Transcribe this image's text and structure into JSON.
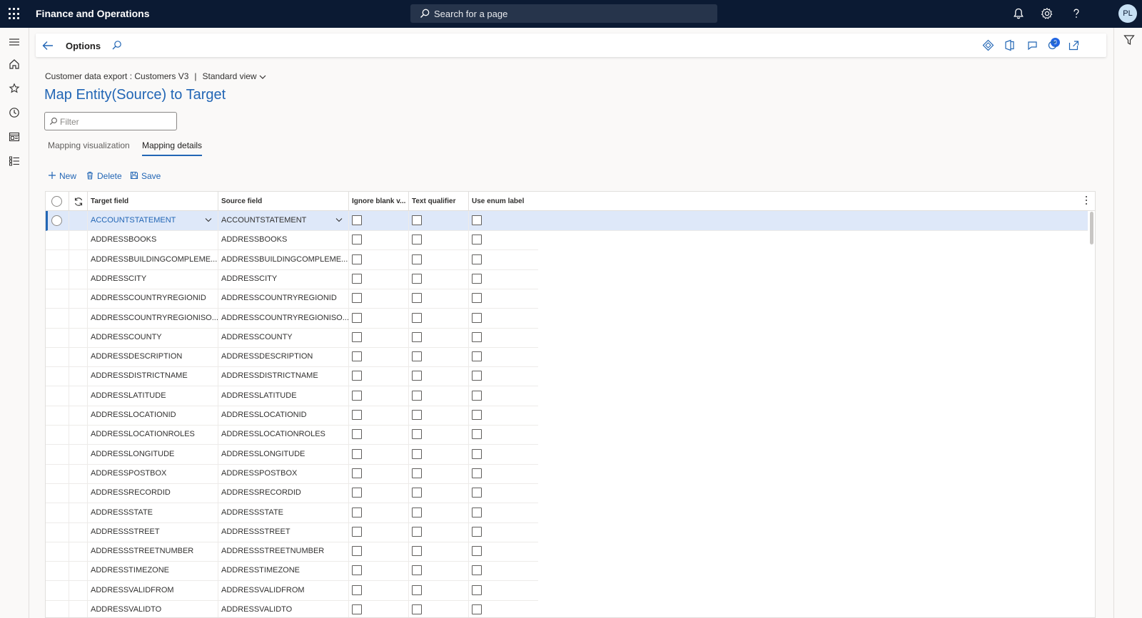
{
  "topbar": {
    "app_title": "Finance and Operations",
    "search_placeholder": "Search for a page",
    "avatar_initials": "PL"
  },
  "actionpane": {
    "title": "Options",
    "notification_count": "0"
  },
  "header": {
    "breadcrumb": "Customer data export : Customers V3",
    "separator": "|",
    "view_name": "Standard view",
    "page_title": "Map Entity(Source) to Target",
    "filter_placeholder": "Filter"
  },
  "tabs": [
    {
      "label": "Mapping visualization"
    },
    {
      "label": "Mapping details"
    }
  ],
  "toolbar": {
    "new_label": "New",
    "delete_label": "Delete",
    "save_label": "Save"
  },
  "grid": {
    "columns": {
      "target": "Target field",
      "source": "Source field",
      "ignore_blank": "Ignore blank v...",
      "text_qualifier": "Text qualifier",
      "use_enum": "Use enum label"
    },
    "rows": [
      {
        "target": "ACCOUNTSTATEMENT",
        "source": "ACCOUNTSTATEMENT"
      },
      {
        "target": "ADDRESSBOOKS",
        "source": "ADDRESSBOOKS"
      },
      {
        "target": "ADDRESSBUILDINGCOMPLEME...",
        "source": "ADDRESSBUILDINGCOMPLEME..."
      },
      {
        "target": "ADDRESSCITY",
        "source": "ADDRESSCITY"
      },
      {
        "target": "ADDRESSCOUNTRYREGIONID",
        "source": "ADDRESSCOUNTRYREGIONID"
      },
      {
        "target": "ADDRESSCOUNTRYREGIONISO...",
        "source": "ADDRESSCOUNTRYREGIONISO..."
      },
      {
        "target": "ADDRESSCOUNTY",
        "source": "ADDRESSCOUNTY"
      },
      {
        "target": "ADDRESSDESCRIPTION",
        "source": "ADDRESSDESCRIPTION"
      },
      {
        "target": "ADDRESSDISTRICTNAME",
        "source": "ADDRESSDISTRICTNAME"
      },
      {
        "target": "ADDRESSLATITUDE",
        "source": "ADDRESSLATITUDE"
      },
      {
        "target": "ADDRESSLOCATIONID",
        "source": "ADDRESSLOCATIONID"
      },
      {
        "target": "ADDRESSLOCATIONROLES",
        "source": "ADDRESSLOCATIONROLES"
      },
      {
        "target": "ADDRESSLONGITUDE",
        "source": "ADDRESSLONGITUDE"
      },
      {
        "target": "ADDRESSPOSTBOX",
        "source": "ADDRESSPOSTBOX"
      },
      {
        "target": "ADDRESSRECORDID",
        "source": "ADDRESSRECORDID"
      },
      {
        "target": "ADDRESSSTATE",
        "source": "ADDRESSSTATE"
      },
      {
        "target": "ADDRESSSTREET",
        "source": "ADDRESSSTREET"
      },
      {
        "target": "ADDRESSSTREETNUMBER",
        "source": "ADDRESSSTREETNUMBER"
      },
      {
        "target": "ADDRESSTIMEZONE",
        "source": "ADDRESSTIMEZONE"
      },
      {
        "target": "ADDRESSVALIDFROM",
        "source": "ADDRESSVALIDFROM"
      },
      {
        "target": "ADDRESSVALIDTO",
        "source": "ADDRESSVALIDTO"
      }
    ]
  },
  "colors": {
    "topbar": "#0b1a33",
    "accent": "#2266b5",
    "selected_row": "#dee8f9"
  }
}
